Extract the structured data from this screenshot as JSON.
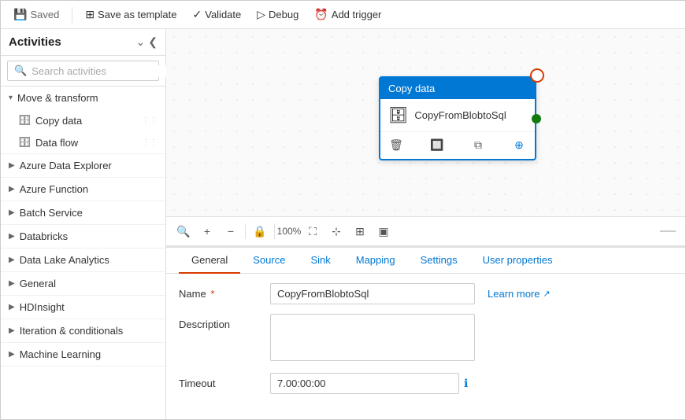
{
  "toolbar": {
    "saved_label": "Saved",
    "save_as_template_label": "Save as template",
    "validate_label": "Validate",
    "debug_label": "Debug",
    "add_trigger_label": "Add trigger"
  },
  "left_panel": {
    "title": "Activities",
    "search_placeholder": "Search activities",
    "collapse_icon": "❮❮",
    "move_transform": {
      "label": "Move & transform",
      "items": [
        {
          "name": "Copy data",
          "icon": "🗄"
        },
        {
          "name": "Data flow",
          "icon": "🗄"
        }
      ]
    },
    "categories": [
      {
        "label": "Azure Data Explorer"
      },
      {
        "label": "Azure Function"
      },
      {
        "label": "Batch Service"
      },
      {
        "label": "Databricks"
      },
      {
        "label": "Data Lake Analytics"
      },
      {
        "label": "General"
      },
      {
        "label": "HDInsight"
      },
      {
        "label": "Iteration & conditionals"
      },
      {
        "label": "Machine Learning"
      }
    ]
  },
  "canvas": {
    "node": {
      "header": "Copy data",
      "name": "CopyFromBlobtoSql",
      "percent": "100%"
    }
  },
  "bottom_panel": {
    "tabs": [
      {
        "label": "General",
        "active": true
      },
      {
        "label": "Source",
        "active": false
      },
      {
        "label": "Sink",
        "active": false
      },
      {
        "label": "Mapping",
        "active": false
      },
      {
        "label": "Settings",
        "active": false
      },
      {
        "label": "User properties",
        "active": false
      }
    ],
    "form": {
      "name_label": "Name",
      "name_value": "CopyFromBlobtoSql",
      "name_placeholder": "CopyFromBlobtoSql",
      "description_label": "Description",
      "description_placeholder": "",
      "timeout_label": "Timeout",
      "timeout_value": "7.00:00:00",
      "learn_more_label": "Learn more"
    }
  }
}
